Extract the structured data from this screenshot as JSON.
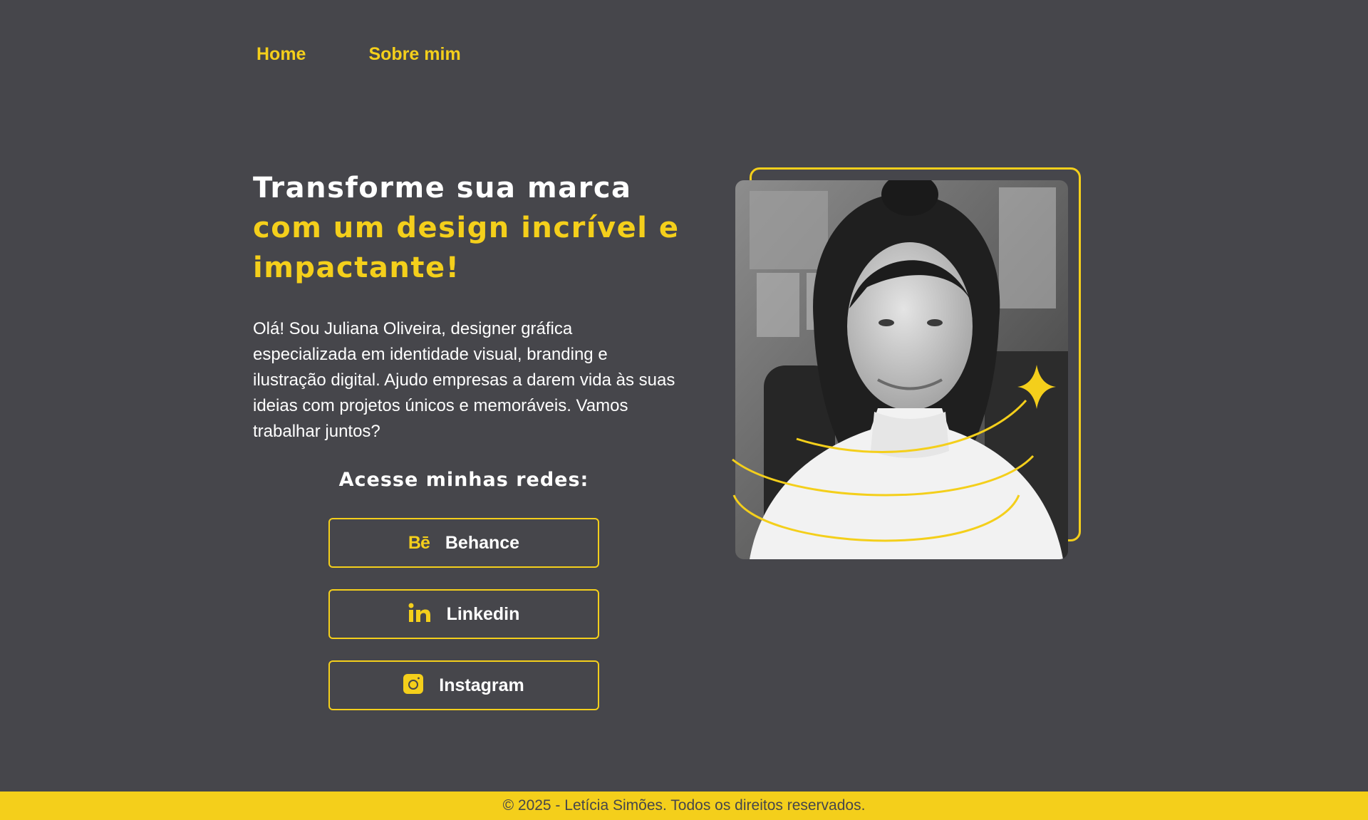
{
  "nav": {
    "home": "Home",
    "about": "Sobre mim"
  },
  "hero": {
    "title_line1": "Transforme sua marca",
    "title_line2": "com um design incrível e impactante!",
    "intro": "Olá! Sou Juliana Oliveira, designer gráfica especializada em identidade visual, branding e ilustração digital. Ajudo empresas a darem vida às suas ideias com projetos únicos e memoráveis. Vamos trabalhar juntos?"
  },
  "social": {
    "heading": "Acesse minhas redes:",
    "buttons": [
      {
        "label": "Behance",
        "icon": "behance-icon",
        "icon_text": "Bē"
      },
      {
        "label": "Linkedin",
        "icon": "linkedin-icon"
      },
      {
        "label": "Instagram",
        "icon": "instagram-icon"
      }
    ]
  },
  "footer": {
    "text": "© 2025 - Letícia Simões. Todos os direitos reservados."
  },
  "colors": {
    "background": "#46464b",
    "accent": "#f4cf1b",
    "text": "#ffffff"
  }
}
